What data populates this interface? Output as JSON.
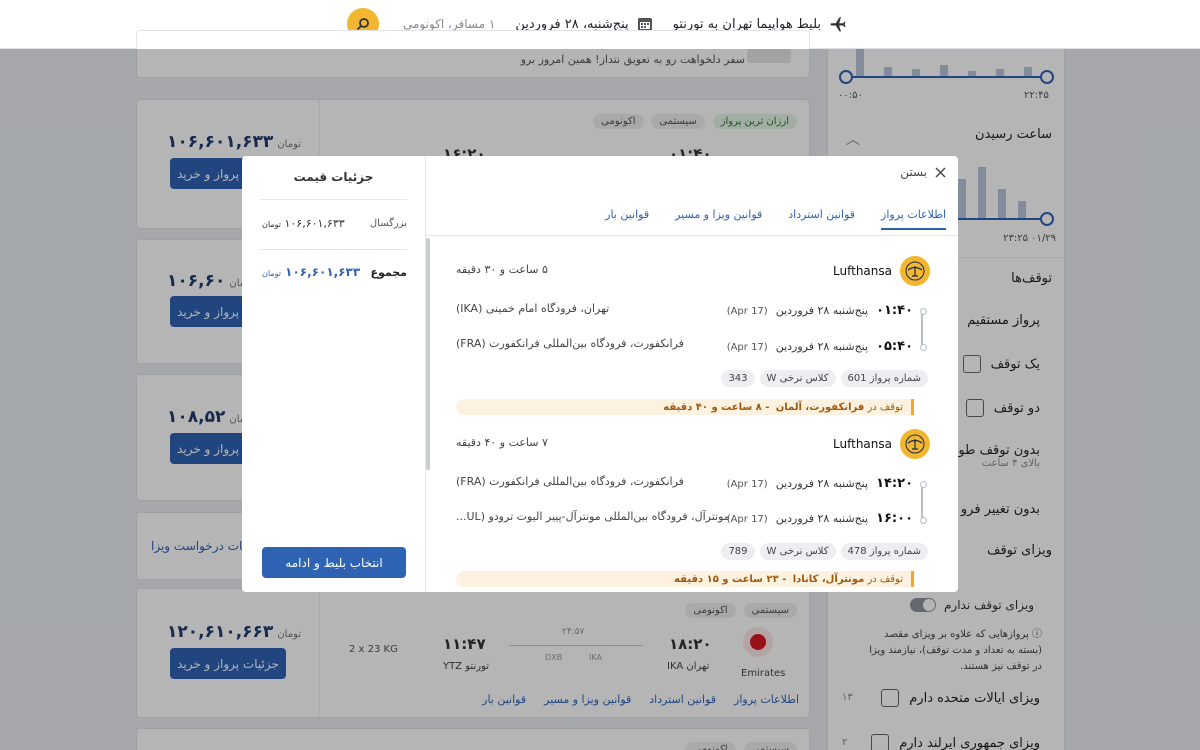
{
  "header": {
    "route": "بلیط هواپیما تهران به تورنتو",
    "date": "پنج‌شنبه، ۲۸ فروردین",
    "passengers": "۱ مسافر، اکونومی"
  },
  "bg": {
    "top_card_text": "سفر دلخواهت رو به تعویق نتداز! همین امروز برو",
    "cards": [
      {
        "price": "۱۰۶,۶۰۱,۶۳۳",
        "currency": "تومان",
        "button": "جزئیات پرواز و خرید",
        "tags": [
          "اکونومی",
          "سیستمی",
          "ارزان ترین پرواز"
        ],
        "dep_time": "۰۱:۴۰",
        "arr_time": "۱۶:۲۰"
      },
      {
        "price": "۱۰۶,۶۰",
        "currency": "تومان",
        "button": "جزئیات پرواز و خرید"
      },
      {
        "price": "۱۰۸,۵۲",
        "currency": "تومان",
        "button": "جزئیات پرواز و خرید"
      },
      {
        "visa_link": "جزئیات درخواست ویزا"
      },
      {
        "price": "۱۲۰,۶۱۰,۶۶۳",
        "currency": "تومان",
        "button": "جزئیات پرواز و خرید",
        "tags": [
          "اکونومی",
          "سیستمی"
        ],
        "airline": "Emirates",
        "dep_time": "۱۸:۲۰",
        "dep_city": "تهران IKA",
        "arr_time": "۱۱:۴۷",
        "arr_city": "تورنتو YTZ",
        "duration": "۲۴:۵۷",
        "stops": [
          "DXB",
          "IKA"
        ],
        "baggage": "2 x 23 KG",
        "links": [
          "اطلاعات پرواز",
          "قوانین استرداد",
          "قوانین ویزا و مسیر",
          "قوانین بار"
        ]
      },
      {
        "tags": [
          "اکونومی",
          "سیستمی"
        ]
      }
    ]
  },
  "sidebar": {
    "dep_range_start": "۰۰:۵۰",
    "dep_range_end": "۲۲:۴۵",
    "arrival_title": "ساعت رسیدن",
    "arr_range_start": "۰۱/۲۹ ۲۳:۲۵",
    "stops_title": "توقف‌ها",
    "stop_options": [
      {
        "label": "پرواز مستقیم"
      },
      {
        "label": "یک توقف"
      },
      {
        "label": "دو توقف"
      },
      {
        "label": "بدون توقف طو",
        "sub": "بالای ۴ ساعت"
      },
      {
        "label": "بدون تغییر فرو"
      }
    ],
    "transit_visa_title": "ویزای توقف",
    "no_transit_visa": "ویزای توقف ندارم",
    "transit_note": "پروازهایی که علاوه بر ویزای مقصد (بسته به تعداد و مدت توقف)، نیازمند ویزا در توقف نیز هستند.",
    "visa_options": [
      {
        "label": "ویزای ایالات متحده دارم",
        "count": "۱۳"
      },
      {
        "label": "ویزای جمهوری ایرلند دارم",
        "count": "۲"
      }
    ]
  },
  "modal": {
    "close_label": "بستن",
    "tabs": [
      "اطلاعات پرواز",
      "قوانین استرداد",
      "قوانین ویزا و مسیر",
      "قوانین بار"
    ],
    "price_title": "جزئیات قیمت",
    "adult_label": "بزرگسال",
    "adult_price": "۱۰۶,۶۰۱,۶۳۳",
    "currency": "تومان",
    "total_label": "مجموع",
    "total_price": "۱۰۶,۶۰۱,۶۳۳",
    "select_button": "انتخاب بلیط و ادامه",
    "segments": [
      {
        "airline": "Lufthansa",
        "duration": "۵ ساعت و ۳۰ دقیقه",
        "dep_time": "۰۱:۴۰",
        "dep_date": "پنج‌شنبه ۲۸ فروردین",
        "dep_date_en": "(Apr 17)",
        "dep_place": "تهران، فرودگاه امام خمینی (IKA)",
        "arr_time": "۰۵:۴۰",
        "arr_date": "پنج‌شنبه ۲۸ فروردین",
        "arr_date_en": "(Apr 17)",
        "arr_place": "فرانکفورت، فرودگاه بین‌المللی فرانکفورت (FRA)",
        "chips": [
          "شماره پرواز  601",
          "کلاس نرخی W",
          "343"
        ],
        "stop_prefix": "توقف در",
        "stop_city": "فرانکفورت، آلمان",
        "stop_time": "- ۸ ساعت و ۴۰ دقیقه"
      },
      {
        "airline": "Lufthansa",
        "duration": "۷ ساعت و ۴۰ دقیقه",
        "dep_time": "۱۴:۲۰",
        "dep_date": "پنج‌شنبه ۲۸ فروردین",
        "dep_date_en": "(Apr 17)",
        "dep_place": "فرانکفورت، فرودگاه بین‌المللی فرانکفورت (FRA)",
        "arr_time": "۱۶:۰۰",
        "arr_date": "پنج‌شنبه ۲۸ فروردین",
        "arr_date_en": "(Apr 17)",
        "arr_place": "مونترآل، فرودگاه بین‌المللی مونترآل-پییر الیوت ترودو (UL...",
        "chips": [
          "شماره پرواز  478",
          "کلاس نرخی W",
          "789"
        ],
        "stop_prefix": "توقف در",
        "stop_city": "مونترآل، کانادا",
        "stop_time": "- ۲۳ ساعت و ۱۵ دقیقه"
      }
    ]
  },
  "colors": {
    "primary": "#2e62b3",
    "accent": "#f2b630",
    "stop_bg": "#fdf1df",
    "stop_text": "#a0580c"
  }
}
